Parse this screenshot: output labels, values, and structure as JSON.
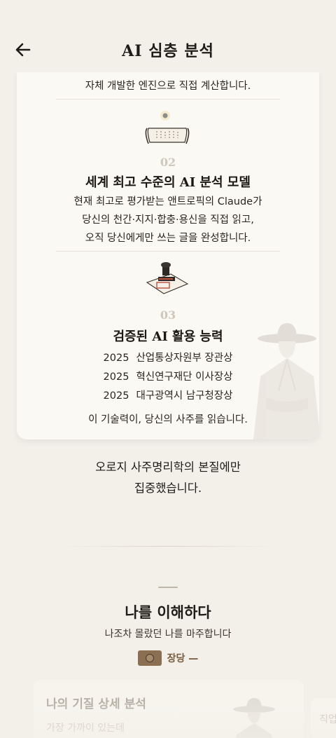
{
  "header": {
    "title": "AI 심층 분석",
    "back_icon": "arrow-left-icon"
  },
  "card": {
    "top_line": "자체 개발한 엔진으로 직접 계산합니다.",
    "feature2": {
      "num": "02",
      "title": "세계 최고 수준의 AI 분석 모델",
      "lines": [
        "현재 최고로 평가받는 앤트로픽의 Claude가",
        "당신의 천간·지지·합충·용신을 직접 읽고,",
        "오직 당신에게만 쓰는 글을 완성합니다."
      ]
    },
    "feature3": {
      "num": "03",
      "title": "검증된 AI 활용 능력",
      "awards": [
        {
          "year": "2025",
          "name": "산업통상자원부 장관상"
        },
        {
          "year": "2025",
          "name": "혁신연구재단 이사장상"
        },
        {
          "year": "2025",
          "name": "대구광역시 남구청장상"
        }
      ],
      "closing": "이 기술력이, 당신의 사주를 읽습니다."
    }
  },
  "focus": {
    "line1": "오로지 사주명리학의 본질에만",
    "line2": "집중했습니다."
  },
  "section": {
    "title": "나를 이해하다",
    "subtitle": "나조차 몰랐던 나를 마주합니다",
    "tag": "장당 —"
  },
  "peek": {
    "title": "나의 기질 상세 분석",
    "subtitle": "가장 가까이 있는데",
    "right_text": "직업"
  }
}
